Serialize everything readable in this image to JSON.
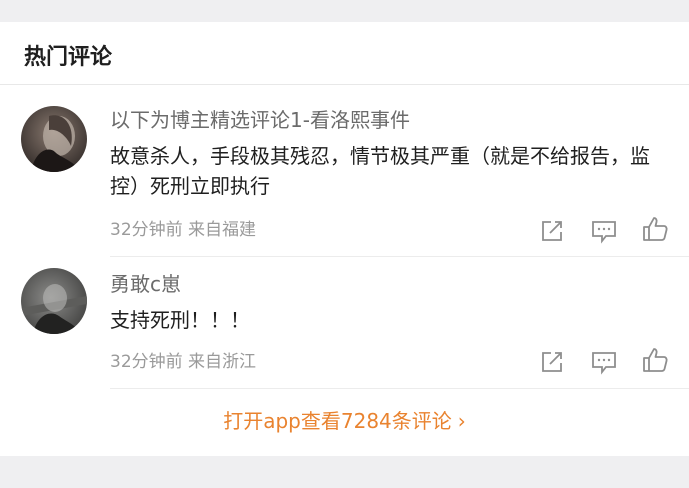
{
  "section": {
    "title": "热门评论"
  },
  "comments": [
    {
      "name": "以下为博主精选评论1-看洛熙事件",
      "text": "故意杀人，手段极其残忍，情节极其严重（就是不给报告，监控）死刑立即执行",
      "time": "32分钟前",
      "location": "来自福建"
    },
    {
      "name": "勇敢c崽",
      "text": "支持死刑！！！",
      "time": "32分钟前",
      "location": "来自浙江"
    }
  ],
  "footer": {
    "open_app_label": "打开app查看7284条评论",
    "chevron": "›"
  },
  "icons": {
    "share": "share-icon",
    "comment": "comment-icon",
    "like": "thumbs-up-icon"
  },
  "colors": {
    "accent": "#e9832f",
    "band": "#efeff1",
    "text_primary": "#1f1f1f",
    "text_secondary": "#6b6b6b",
    "text_meta": "#9a9a9a"
  }
}
